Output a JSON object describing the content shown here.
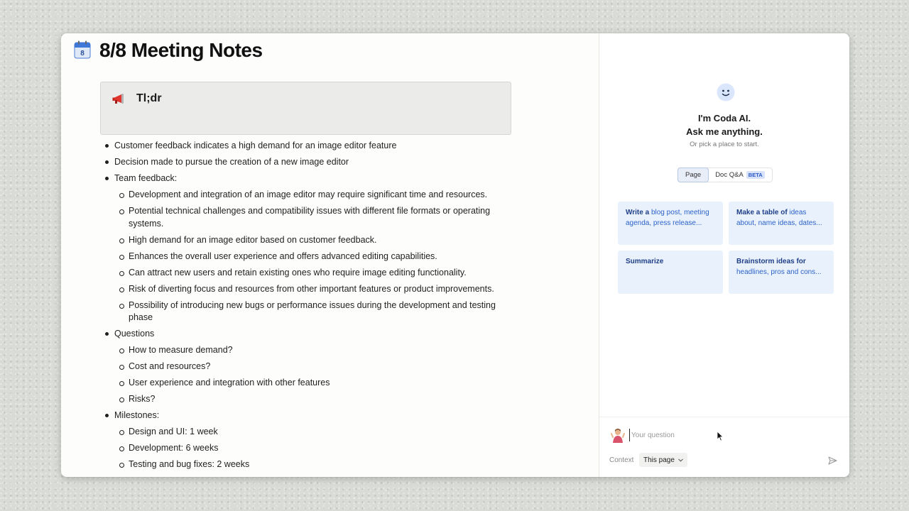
{
  "doc": {
    "calendar_day": "8",
    "title": "8/8 Meeting Notes",
    "callout_title": "Tl;dr",
    "bullets": [
      {
        "text": "Customer feedback indicates a high demand for an image editor feature"
      },
      {
        "text": "Decision made to pursue the creation of a new image editor"
      },
      {
        "text": "Team feedback:",
        "children": [
          "Development and integration of an image editor may require significant time and resources.",
          "Potential technical challenges and compatibility issues with different file formats or operating systems.",
          "High demand for an image editor based on customer feedback.",
          "Enhances the overall user experience and offers advanced editing capabilities.",
          "Can attract new users and retain existing ones who require image editing functionality.",
          "Risk of diverting focus and resources from other important features or product improvements.",
          "Possibility of introducing new bugs or performance issues during the development and testing phase"
        ]
      },
      {
        "text": "Questions",
        "children": [
          "How to measure demand?",
          "Cost and resources?",
          "User experience and integration with other features",
          "Risks?"
        ]
      },
      {
        "text": "Milestones:",
        "children": [
          "Design and UI: 1 week",
          "Development: 6 weeks",
          "Testing and bug fixes: 2 weeks"
        ]
      }
    ]
  },
  "ai_panel": {
    "title_line1": "I'm Coda AI.",
    "title_line2": "Ask me anything.",
    "subtitle": "Or pick a place to start.",
    "tabs": {
      "page": "Page",
      "doc_qa": "Doc Q&A",
      "beta": "BETA"
    },
    "suggestions": [
      {
        "bold": "Write a",
        "rest": " blog post, meeting agenda, press release..."
      },
      {
        "bold": "Make a table of",
        "rest": " ideas about, name ideas, dates..."
      },
      {
        "bold": "Summarize",
        "rest": ""
      },
      {
        "bold": "Brainstorm ideas for",
        "rest": " headlines, pros and cons..."
      }
    ],
    "input_placeholder": "Your question",
    "context_label": "Context",
    "context_value": "This page"
  },
  "colors": {
    "accent": "#2d63c8",
    "card_bg": "#e9f1fd",
    "callout_bg": "#ebebea"
  },
  "icons": [
    "calendar-icon",
    "megaphone-icon",
    "coda-ai-face-icon",
    "user-avatar",
    "chevron-down-icon",
    "send-icon"
  ]
}
